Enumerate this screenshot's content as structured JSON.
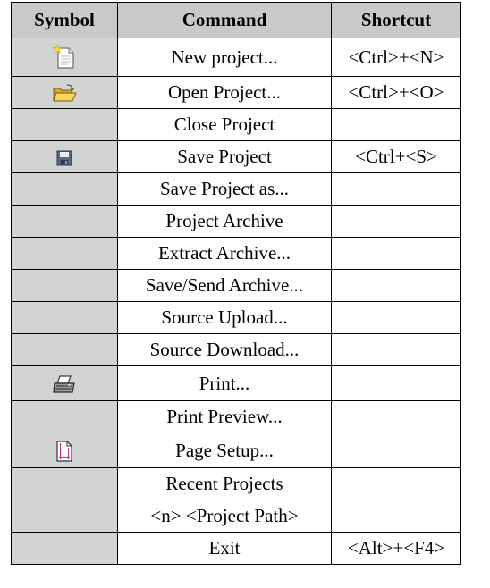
{
  "headers": {
    "symbol": "Symbol",
    "command": "Command",
    "shortcut": "Shortcut"
  },
  "rows": [
    {
      "icon": "new-project-icon",
      "command": "New project...",
      "shortcut": "<Ctrl>+<N>"
    },
    {
      "icon": "open-folder-icon",
      "command": "Open Project...",
      "shortcut": "<Ctrl>+<O>"
    },
    {
      "icon": "",
      "command": "Close Project",
      "shortcut": ""
    },
    {
      "icon": "save-disk-icon",
      "command": "Save Project",
      "shortcut": "<Ctrl+<S>"
    },
    {
      "icon": "",
      "command": "Save Project as...",
      "shortcut": ""
    },
    {
      "icon": "",
      "command": "Project Archive",
      "shortcut": ""
    },
    {
      "icon": "",
      "command": "Extract Archive...",
      "shortcut": ""
    },
    {
      "icon": "",
      "command": "Save/Send Archive...",
      "shortcut": ""
    },
    {
      "icon": "",
      "command": "Source Upload...",
      "shortcut": ""
    },
    {
      "icon": "",
      "command": "Source Download...",
      "shortcut": ""
    },
    {
      "icon": "printer-icon",
      "command": "Print...",
      "shortcut": ""
    },
    {
      "icon": "",
      "command": "Print Preview...",
      "shortcut": ""
    },
    {
      "icon": "page-setup-icon",
      "command": "Page Setup...",
      "shortcut": ""
    },
    {
      "icon": "",
      "command": "Recent Projects",
      "shortcut": ""
    },
    {
      "icon": "",
      "command": "<n> <Project Path>",
      "shortcut": ""
    },
    {
      "icon": "",
      "command": "Exit",
      "shortcut": "<Alt>+<F4>"
    }
  ],
  "colors": {
    "symbol_cell": "#d3d3d3",
    "header_symbol": "#c9c9c9",
    "border": "#000000"
  }
}
